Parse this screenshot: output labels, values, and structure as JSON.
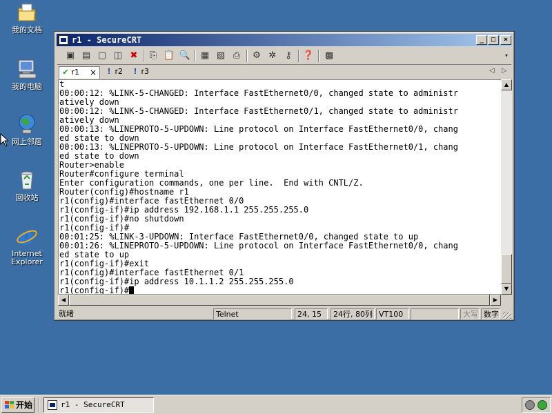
{
  "desktop": {
    "icons": [
      {
        "label": "我的文档",
        "icon": "my-documents-icon"
      },
      {
        "label": "我的电脑",
        "icon": "my-computer-icon"
      },
      {
        "label": "网上邻居",
        "icon": "network-places-icon"
      },
      {
        "label": "回收站",
        "icon": "recycle-bin-icon"
      },
      {
        "label_line1": "Internet",
        "label_line2": "Explorer",
        "icon": "internet-explorer-icon"
      }
    ]
  },
  "window": {
    "title": "r1 - SecureCRT",
    "controls": {
      "minimize": "_",
      "maximize": "□",
      "close": "×"
    }
  },
  "toolbar": {
    "buttons": [
      "connect-icon",
      "quick-connect-icon",
      "connect-tab-icon",
      "reconnect-icon",
      "disconnect-icon",
      "copy-icon",
      "paste-icon",
      "find-icon",
      "print-setup-icon",
      "print-selection-icon",
      "print-icon",
      "session-options-icon",
      "global-options-icon",
      "key-icon",
      "help-icon",
      "keymap-icon"
    ]
  },
  "tabs": [
    {
      "label": "r1",
      "status": "✔",
      "close": "×"
    },
    {
      "label": "r2",
      "status": "!"
    },
    {
      "label": "r3",
      "status": "!"
    }
  ],
  "tab_nav": {
    "prev": "◁",
    "next": "▷"
  },
  "terminal": {
    "lines": [
      "t",
      "00:00:12: %LINK-5-CHANGED: Interface FastEthernet0/0, changed state to administr",
      "atively down",
      "00:00:12: %LINK-5-CHANGED: Interface FastEthernet0/1, changed state to administr",
      "atively down",
      "00:00:13: %LINEPROTO-5-UPDOWN: Line protocol on Interface FastEthernet0/0, chang",
      "ed state to down",
      "00:00:13: %LINEPROTO-5-UPDOWN: Line protocol on Interface FastEthernet0/1, chang",
      "ed state to down",
      "Router>enable",
      "Router#configure terminal",
      "Enter configuration commands, one per line.  End with CNTL/Z.",
      "Router(config)#hostname r1",
      "r1(config)#interface fastEthernet 0/0",
      "r1(config-if)#ip address 192.168.1.1 255.255.255.0",
      "r1(config-if)#no shutdown",
      "r1(config-if)#",
      "00:01:25: %LINK-3-UPDOWN: Interface FastEthernet0/0, changed state to up",
      "00:01:26: %LINEPROTO-5-UPDOWN: Line protocol on Interface FastEthernet0/0, chang",
      "ed state to up",
      "r1(config-if)#exit",
      "r1(config)#interface fastEthernet 0/1",
      "r1(config-if)#ip address 10.1.1.2 255.255.255.0"
    ],
    "prompt": "r1(config-if)#"
  },
  "scrollbars": {
    "up": "▲",
    "down": "▼",
    "left": "◀",
    "right": "▶"
  },
  "statusbar": {
    "ready": "就绪",
    "protocol": "Telnet",
    "cursor_pos": "24, 15",
    "size": "24行, 80列",
    "emulation": "VT100",
    "caps": "大写",
    "num": "数字"
  },
  "taskbar": {
    "start_label": "开始",
    "task_label": "r1 - SecureCRT"
  }
}
